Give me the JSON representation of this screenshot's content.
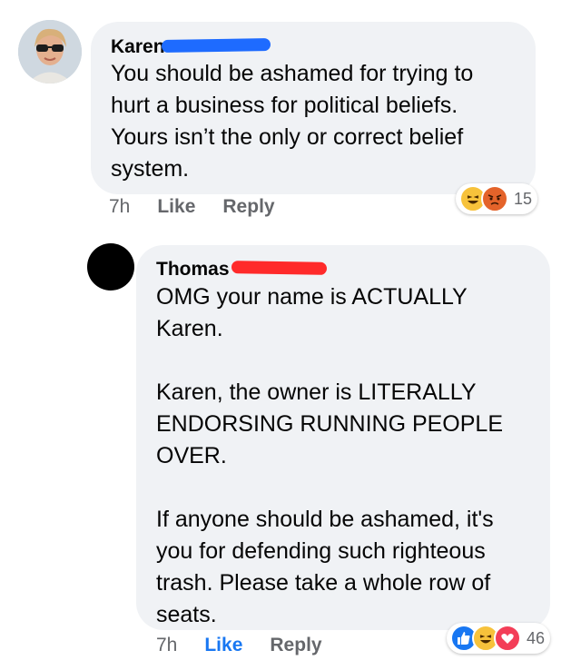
{
  "comments": [
    {
      "author": "Karen",
      "text": "You should be ashamed for trying to\nhurt a business for political beliefs.\nYours isn’t the only or correct belief\nsystem.",
      "time": "7h",
      "like": "Like",
      "reply": "Reply",
      "reaction_count": "15",
      "reactions": [
        "haha-icon",
        "angry-icon"
      ]
    },
    {
      "author": "Thomas",
      "text": "OMG your name is ACTUALLY\nKaren.\n\nKaren, the owner is LITERALLY\nENDORSING RUNNING PEOPLE\nOVER.\n\nIf anyone should be ashamed, it's\nyou for defending such righteous\ntrash.  Please take a whole row of\nseats.",
      "time": "7h",
      "like": "Like",
      "reply": "Reply",
      "reaction_count": "46",
      "reactions": [
        "like-icon",
        "haha-icon",
        "love-icon"
      ]
    }
  ],
  "colors": {
    "bubble": "#f0f2f5",
    "like_active": "#1877f2",
    "meta": "#65676b",
    "redaction_blue": "#1e6bff",
    "redaction_red": "#ff2a2a"
  }
}
